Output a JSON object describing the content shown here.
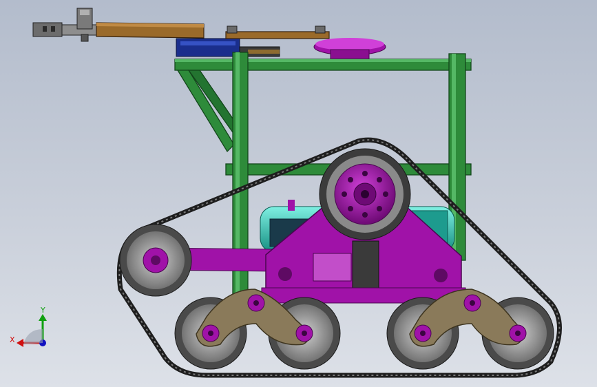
{
  "viewport": {
    "background_top": "#b3bccc",
    "background_bottom": "#dde1e8"
  },
  "colors": {
    "frame": "#2e8b3a",
    "frame_dark": "#1c5e26",
    "hub": "#a012a8",
    "hub_dark": "#5e0a63",
    "bogie_plate": "#8a7a5a",
    "track": "#2a2a2a",
    "wheel_rim": "#5a5a5a",
    "engine": "#2fc6b4",
    "arm": "#8b5a1e",
    "blue_block": "#1a2e8c",
    "gripper": "#707070"
  },
  "triad": {
    "x_label": "X",
    "y_label": "Y",
    "x_color": "#d01010",
    "y_color": "#10a010",
    "z_color": "#1010c0"
  },
  "parts": [
    "gripper-assembly",
    "upper-arm-link",
    "lower-arm-link",
    "blue-motor-block",
    "magenta-turntable",
    "green-frame",
    "track-belt",
    "drive-sprocket",
    "front-idler-wheel",
    "bogie-wheels",
    "bogie-plates",
    "engine-block",
    "suspension-bracket"
  ]
}
